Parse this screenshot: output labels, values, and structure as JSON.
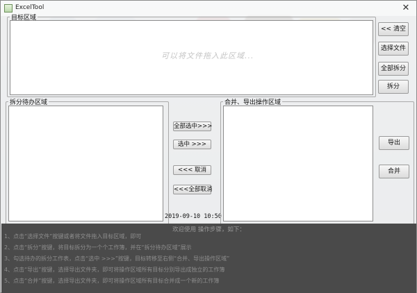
{
  "window": {
    "title": "ExcelTool"
  },
  "target_area": {
    "legend": "目标区域",
    "drop_hint": "可以将文件拖入此区域...",
    "buttons": {
      "clear": "<< 清空",
      "select_file": "选择文件",
      "split_all": "全部拆分",
      "split": "拆分"
    }
  },
  "split_pending": {
    "legend": "拆分待办区域"
  },
  "transfer_buttons": {
    "select_all": "全部选中>>>",
    "select": "选中 >>>",
    "cancel": "<<< 取消",
    "cancel_all": "<<<全部取消"
  },
  "merge_export": {
    "legend": "合并、导出操作区域",
    "buttons": {
      "export": "导出",
      "merge": "合并"
    }
  },
  "datetime": "2019-09-10 10:50",
  "guide": {
    "header": "欢迎使用   操作步骤，如下：",
    "steps": [
      "1、点击“选择文件”按键或者将文件拖入目标区域，即可",
      "2、点击“拆分”按键，将目标拆分为一个个工作簿，并在“拆分待办区域”展示",
      "3、勾选待办的拆分工作表，点击“选中 >>>”按键，目标转移至右侧“合并、导出操作区域”",
      "4、点击“导出”按键，选择导出文件夹，即可将操作区域所有目标分别导出成独立的工作簿",
      "5、点击“合并”按键，选择导出文件夹，即可将操作区域所有目标合并成一个新的工作簿"
    ]
  },
  "colors": {
    "console_bg": "#4a4a4a",
    "console_text": "#8d8d8d",
    "panel_bg": "#ffffff"
  }
}
